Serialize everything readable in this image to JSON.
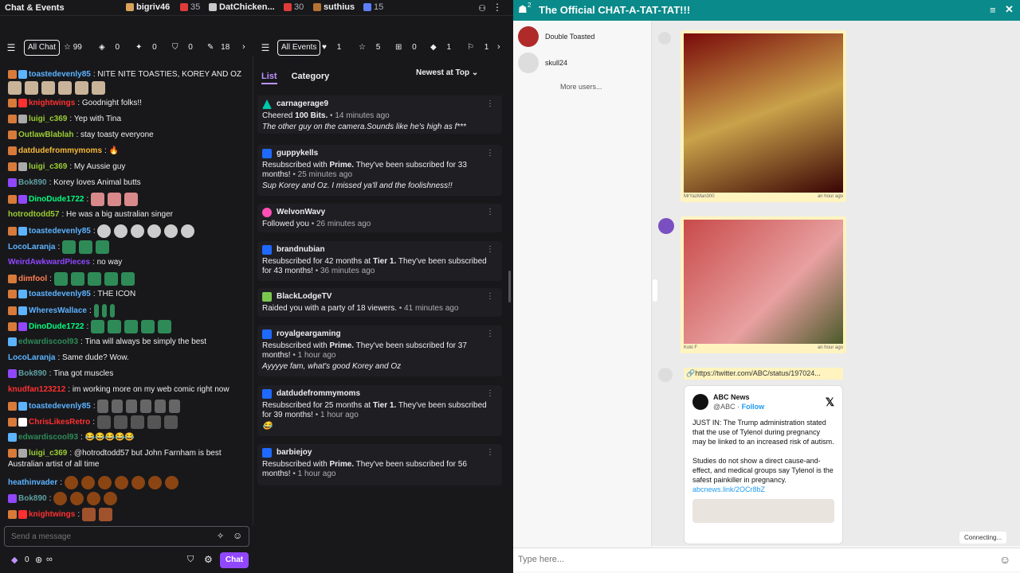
{
  "left": {
    "title": "Chat & Events",
    "top_users": [
      {
        "name": "bigriv46",
        "count": ""
      },
      {
        "name": "",
        "count": "35"
      },
      {
        "name": "DatChicken...",
        "count": ""
      },
      {
        "name": "",
        "count": "30"
      },
      {
        "name": "suthius",
        "count": ""
      },
      {
        "name": "",
        "count": "15"
      }
    ],
    "chat_filter": {
      "label": "All Chat",
      "stars": "99",
      "drop": "0",
      "sparkle": "0",
      "shield": "0",
      "pencil": "18"
    },
    "event_filter": {
      "label": "All Events",
      "hearts": "1",
      "stars": "5",
      "gift": "0",
      "bits": "1",
      "raid": "1"
    },
    "messages": [
      {
        "user": "toastedevenly85",
        "color": "#5cb3ff",
        "text": "NITE NITE TOASTIES, KOREY AND OZ"
      },
      {
        "user": "knightwings",
        "color": "#ff3030",
        "text": "Goodnight folks!!"
      },
      {
        "user": "luigi_c369",
        "color": "#9acd32",
        "text": "Yep with Tina"
      },
      {
        "user": "OutlawBlablah",
        "color": "#9acd32",
        "text": "stay toasty everyone"
      },
      {
        "user": "datdudefrommymoms",
        "color": "#f6b838",
        "text": "🔥"
      },
      {
        "user": "luigi_c369",
        "color": "#9acd32",
        "text": "My Aussie guy"
      },
      {
        "user": "Bok890",
        "color": "#5f9ea0",
        "text": "Korey loves Animal butts"
      },
      {
        "user": "DinoDude1722",
        "color": "#00ff7f",
        "text": ""
      },
      {
        "user": "hotrodtodd57",
        "color": "#9acd32",
        "text": "He was a big australian singer"
      },
      {
        "user": "toastedevenly85",
        "color": "#5cb3ff",
        "text": ""
      },
      {
        "user": "LocoLaranja",
        "color": "#5cb3ff",
        "text": ""
      },
      {
        "user": "WeirdAwkwardPieces",
        "color": "#9147ff",
        "text": "no way"
      },
      {
        "user": "dimfool",
        "color": "#ff7f50",
        "text": ""
      },
      {
        "user": "toastedevenly85",
        "color": "#5cb3ff",
        "text": "THE ICON"
      },
      {
        "user": "WheresWallace",
        "color": "#5cb3ff",
        "text": ""
      },
      {
        "user": "DinoDude1722",
        "color": "#00ff7f",
        "text": ""
      },
      {
        "user": "edwardiscool93",
        "color": "#2e8b57",
        "text": "Tina will always be simply the best"
      },
      {
        "user": "LocoLaranja",
        "color": "#5cb3ff",
        "text": "Same dude? Wow."
      },
      {
        "user": "Bok890",
        "color": "#5f9ea0",
        "text": "Tina got muscles"
      },
      {
        "user": "knudfan123212",
        "color": "#ff3030",
        "text": "im working more on my web comic right now"
      },
      {
        "user": "toastedevenly85",
        "color": "#5cb3ff",
        "text": ""
      },
      {
        "user": "edwardiscool93",
        "color": "#2e8b57",
        "text": "😂😂😂😂😂"
      },
      {
        "user": "luigi_c369",
        "color": "#9acd32",
        "text": "@hotrodtodd57 but John Farnham is best"
      },
      {
        "user": "",
        "color": "#efeff1",
        "text": "Australian artist of all time"
      },
      {
        "user": "heathinvader",
        "color": "#5cb3ff",
        "text": ""
      },
      {
        "user": "Bok890",
        "color": "#5f9ea0",
        "text": ""
      },
      {
        "user": "knightwings",
        "color": "#ff3030",
        "text": ""
      }
    ],
    "input_placeholder": "Send a message",
    "points": "0",
    "chat_button": "Chat",
    "events_tabs": [
      "List",
      "Category"
    ],
    "sort_label": "Newest at Top",
    "events": [
      {
        "user": "carnagerage9",
        "icon_color": "#00c8a8",
        "desc_pre": "Cheered ",
        "desc_bold": "100 Bits.",
        "desc_post": "",
        "time": " • 14 minutes ago",
        "quote": "The other guy on the camera.Sounds like he's high as f***"
      },
      {
        "user": "guppykells",
        "icon_color": "#1f69ff",
        "desc_pre": "Resubscribed with ",
        "desc_bold": "Prime.",
        "desc_post": " They've been subscribed for 33 months!",
        "time": " • 25 minutes ago",
        "quote": "Sup Korey and Oz. I missed ya'll and the foolishness!!"
      },
      {
        "user": "WelvonWavy",
        "icon_color": "#ff4fb5",
        "desc_pre": "Followed you",
        "desc_bold": "",
        "desc_post": "",
        "time": " • 26 minutes ago",
        "quote": ""
      },
      {
        "user": "brandnubian",
        "icon_color": "#1f69ff",
        "desc_pre": "Resubscribed for 42 months at ",
        "desc_bold": "Tier 1.",
        "desc_post": " They've been subscribed for 43 months!",
        "time": " • 36 minutes ago",
        "quote": ""
      },
      {
        "user": "BlackLodgeTV",
        "icon_color": "#7ac74f",
        "desc_pre": "Raided you with a party of 18 viewers.",
        "desc_bold": "",
        "desc_post": "",
        "time": " • 41 minutes ago",
        "quote": ""
      },
      {
        "user": "royalgeargaming",
        "icon_color": "#1f69ff",
        "desc_pre": "Resubscribed with ",
        "desc_bold": "Prime.",
        "desc_post": " They've been subscribed for 37 months!",
        "time": " • 1 hour ago",
        "quote": "Ayyyye fam, what's good Korey and Oz"
      },
      {
        "user": "datdudefrommymoms",
        "icon_color": "#1f69ff",
        "desc_pre": "Resubscribed for 25 months at ",
        "desc_bold": "Tier 1.",
        "desc_post": " They've been subscribed for 39 months!",
        "time": " • 1 hour ago",
        "quote": "😂"
      },
      {
        "user": "barbiejoy",
        "icon_color": "#1f69ff",
        "desc_pre": "Resubscribed with ",
        "desc_bold": "Prime.",
        "desc_post": " They've been subscribed for 56 months!",
        "time": " • 1 hour ago",
        "quote": ""
      }
    ]
  },
  "right": {
    "title": "The Official CHAT-A-TAT-TAT!!!",
    "user_count": "2",
    "users": [
      "Double Toasted",
      "skull24"
    ],
    "more_users": "More users...",
    "cards": [
      {
        "caption_left": "MrYazMan300",
        "caption_right": "an hour ago"
      },
      {
        "caption_left": "Koki F",
        "caption_right": "an hour ago"
      }
    ],
    "link": "https://twitter.com/ABC/status/197024...",
    "tweet": {
      "name": "ABC News",
      "handle": "@ABC · ",
      "follow": "Follow",
      "p1": "JUST IN: The Trump administration stated that the use of Tylenol during pregnancy may be linked to an increased risk of autism.",
      "p2": "Studies do not show a direct cause-and-effect, and medical groups say Tylenol is the safest painkiller in pregnancy.",
      "link": "abcnews.link/2OCr8bZ"
    },
    "connecting": "Connecting...",
    "input_placeholder": "Type here..."
  },
  "colors": {
    "twitch_purple": "#9147ff",
    "teal_header": "#0a8a8a",
    "card_yellow": "#fff4c0"
  }
}
